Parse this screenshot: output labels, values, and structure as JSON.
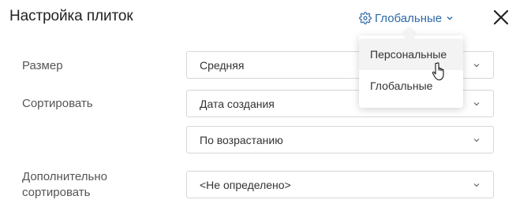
{
  "header": {
    "title": "Настройка плиток",
    "scope_selected": "Глобальные",
    "scope_icon": "gear-icon",
    "accent_color": "#2d6aa8"
  },
  "scope_dropdown": {
    "options": [
      "Персональные",
      "Глобальные"
    ],
    "hovered": "Персональные"
  },
  "form": {
    "size_label": "Размер",
    "size_value": "Средняя",
    "sort_label": "Сортировать",
    "sort_field_value": "Дата создания",
    "sort_order_value": "По возрастанию",
    "extra_sort_label_line1": "Дополнительно",
    "extra_sort_label_line2": "сортировать",
    "extra_sort_value": "<Не определено>"
  }
}
